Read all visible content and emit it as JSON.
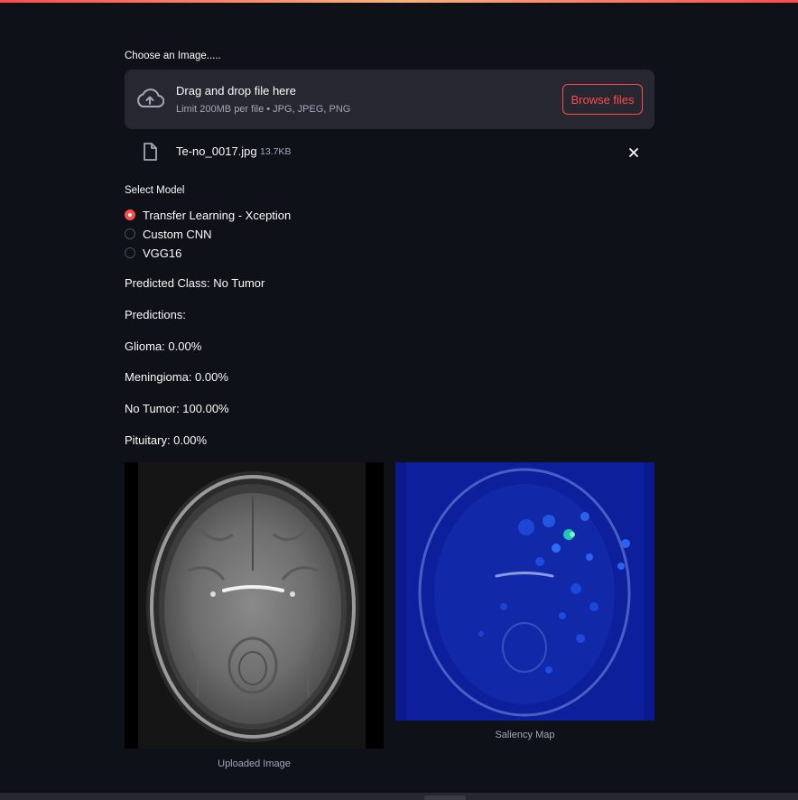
{
  "uploader": {
    "label": "Choose an Image.....",
    "dropzone_title": "Drag and drop file here",
    "dropzone_limit": "Limit 200MB per file • JPG, JPEG, PNG",
    "browse_label": "Browse files",
    "file_name": "Te-no_0017.jpg",
    "file_size": "13.7KB"
  },
  "model_select": {
    "label": "Select Model",
    "options": [
      "Transfer Learning - Xception",
      "Custom CNN",
      "VGG16"
    ],
    "selected": "Transfer Learning - Xception"
  },
  "results": {
    "predicted_class": "Predicted Class: No Tumor",
    "predictions_heading": "Predictions:",
    "lines": [
      "Glioma: 0.00%",
      "Meningioma: 0.00%",
      "No Tumor: 100.00%",
      "Pituitary: 0.00%"
    ]
  },
  "images": {
    "uploaded_caption": "Uploaded Image",
    "saliency_caption": "Saliency Map"
  },
  "icons": {
    "upload": "cloud-upload-icon",
    "file": "file-icon",
    "close": "close-icon"
  },
  "colors": {
    "background": "#0e1117",
    "surface": "#262730",
    "accent": "#ff4b4b",
    "muted_text": "#a3a8b8"
  }
}
